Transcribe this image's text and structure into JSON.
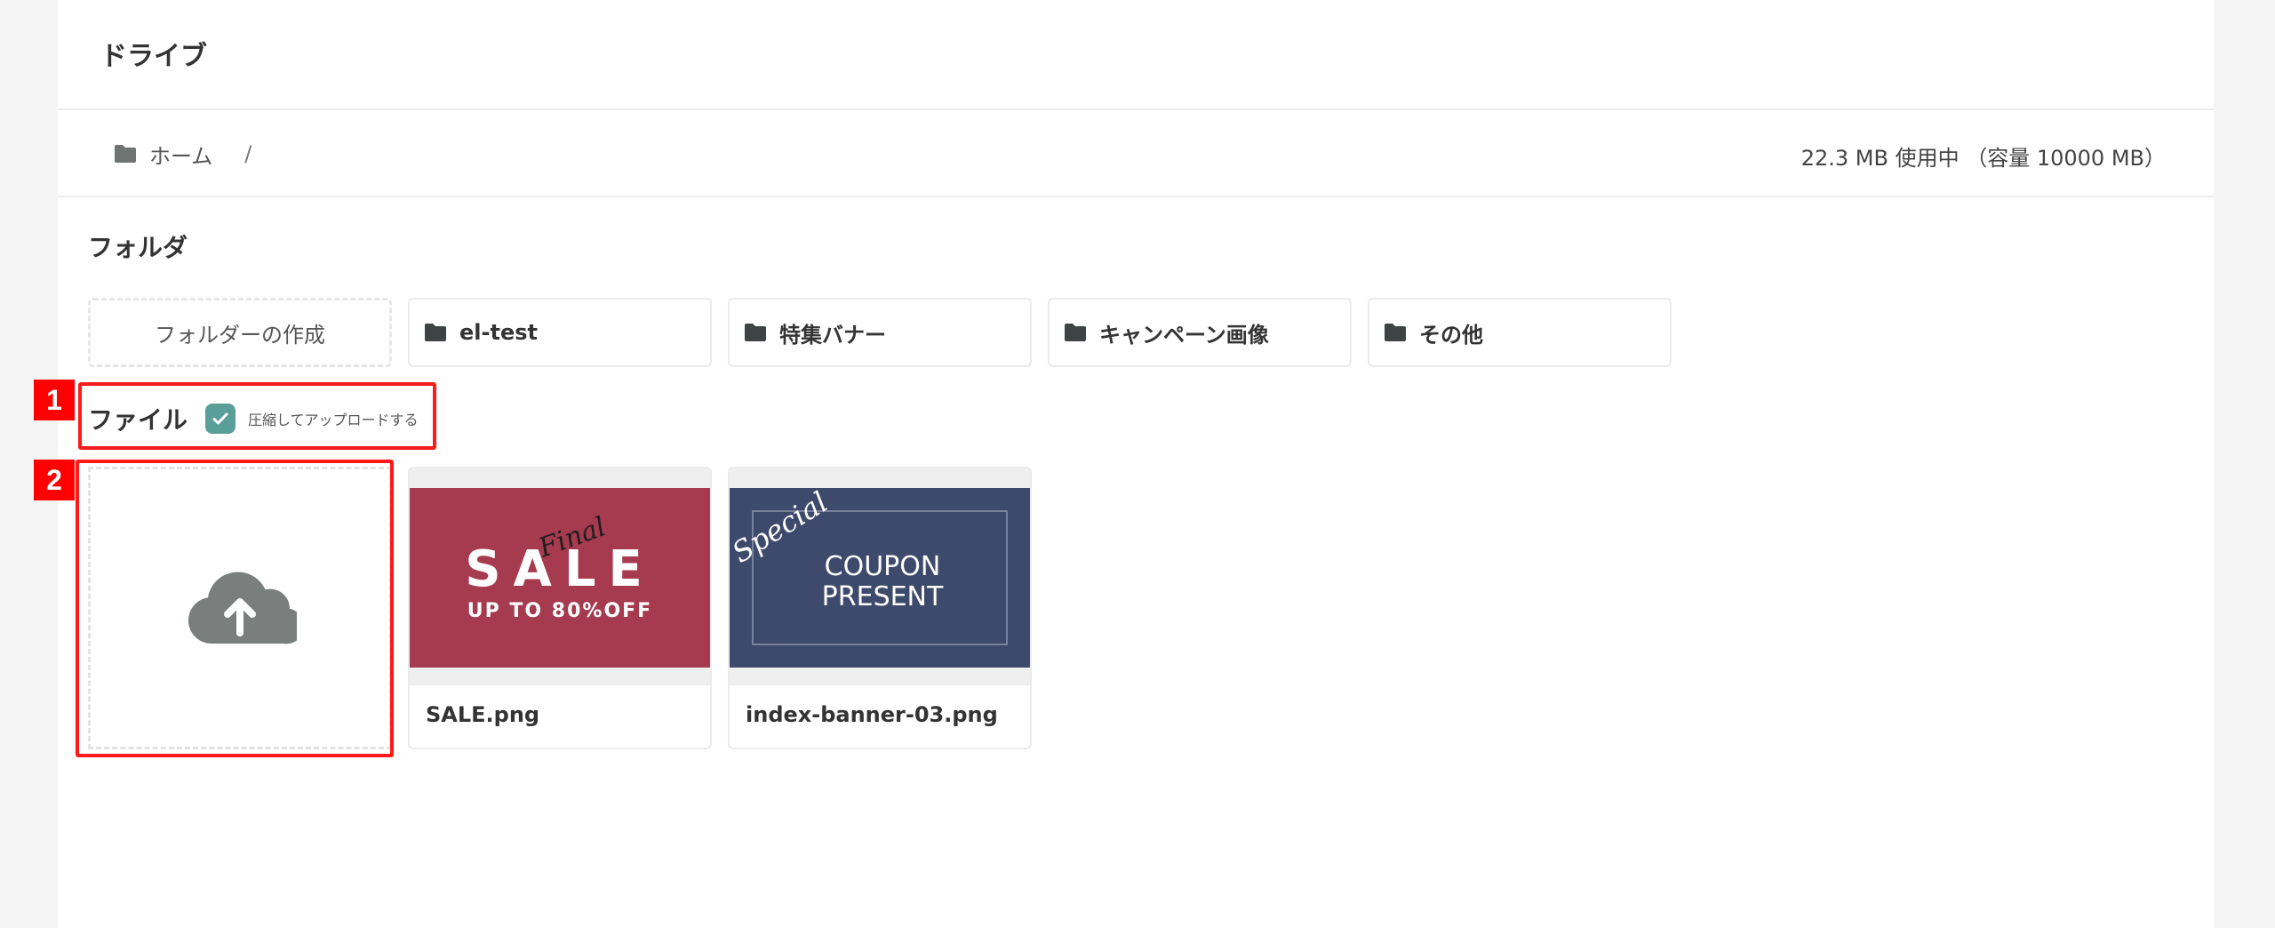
{
  "header": {
    "title": "ドライブ"
  },
  "breadcrumb": {
    "home_label": "ホーム",
    "separator": "/"
  },
  "usage": {
    "text": "22.3 MB 使用中 （容量 10000 MB）"
  },
  "folders_section": {
    "title": "フォルダ",
    "create_label": "フォルダーの作成",
    "items": [
      {
        "label": "el-test"
      },
      {
        "label": "特集バナー"
      },
      {
        "label": "キャンペーン画像"
      },
      {
        "label": "その他"
      }
    ]
  },
  "files_section": {
    "title": "ファイル",
    "compress_checked": true,
    "compress_label": "圧縮してアップロードする",
    "files": [
      {
        "name": "SALE.png",
        "thumb_text": {
          "script": "Final",
          "main": "SALE",
          "sub": "UP TO 80%OFF"
        }
      },
      {
        "name": "index-banner-03.png",
        "thumb_text": {
          "script": "Special",
          "line1": "COUPON",
          "line2": "PRESENT"
        }
      }
    ]
  },
  "annotations": [
    {
      "number": "1",
      "color": "#ff0000"
    },
    {
      "number": "2",
      "color": "#ff0000"
    }
  ],
  "colors": {
    "accent": "#5a9e99",
    "sale_bg": "#a63a4e",
    "coupon_bg": "#3e4a6b",
    "icon_gray": "#7a7f7e"
  }
}
